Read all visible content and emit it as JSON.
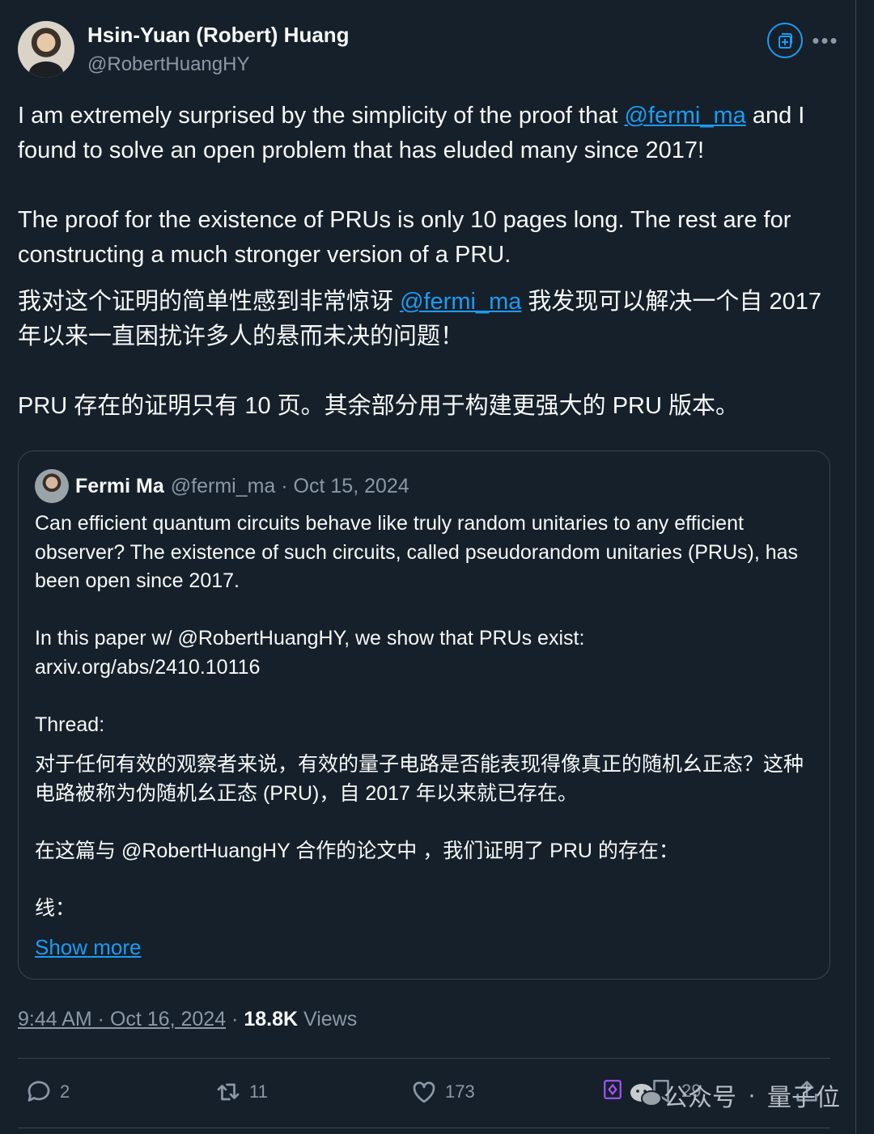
{
  "author": {
    "name": "Hsin-Yuan (Robert) Huang",
    "handle": "@RobertHuangHY"
  },
  "tweet": {
    "p1_a": "I am extremely surprised by the simplicity of the proof that ",
    "p1_mention": "@fermi_ma",
    "p1_b": " and I found to solve an open problem that has eluded many since 2017!",
    "p2": "The proof for the existence of PRUs is only 10 pages long. The rest are for constructing a much stronger version of a PRU.",
    "zh1_a": "我对这个证明的简单性感到非常惊讶 ",
    "zh1_mention": "@fermi_ma",
    "zh1_b": " 我发现可以解决一个自 2017 年以来一直困扰许多人的悬而未决的问题！",
    "zh2": "PRU 存在的证明只有 10 页。其余部分用于构建更强大的 PRU 版本。"
  },
  "quote": {
    "name": "Fermi Ma",
    "meta": "@fermi_ma · Oct 15, 2024",
    "p1": "Can efficient quantum circuits behave like truly random unitaries to any efficient observer? The existence of such circuits, called pseudorandom unitaries (PRUs), has been open since 2017.",
    "p2": "In this paper w/ @RobertHuangHY, we show that PRUs exist:",
    "p2_link": "arxiv.org/abs/2410.10116",
    "p3": "Thread:",
    "zh1": "对于任何有效的观察者来说，有效的量子电路是否能表现得像真正的随机幺正态？这种电路被称为伪随机幺正态 (PRU)，自 2017 年以来就已存在。",
    "zh2": "在这篇与 @RobertHuangHY 合作的论文中 ，我们证明了 PRU 的存在：",
    "zh3": "线：",
    "show_more": "Show more"
  },
  "meta": {
    "time": "9:44 AM · Oct 16, 2024",
    "sep": " · ",
    "views_count": "18.8K",
    "views_label": " Views"
  },
  "actions": {
    "replies": "2",
    "reposts": "11",
    "likes": "173",
    "bookmarks": "29"
  },
  "watermark": {
    "left": "公众号",
    "sep": "·",
    "right": "量子位"
  },
  "icons": [
    "subscribe-icon",
    "more-icon",
    "reply-icon",
    "repost-icon",
    "like-icon",
    "bookmark-icon",
    "share-icon",
    "grok-icon",
    "wechat-icon"
  ],
  "colors": {
    "background": "#15202b",
    "accent": "#1d9bf0",
    "muted": "#8b98a5",
    "border": "#38444d"
  }
}
